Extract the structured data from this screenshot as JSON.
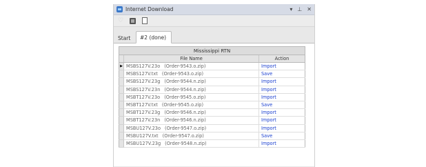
{
  "window": {
    "title": "Internet Download",
    "icon": "globe-download-icon",
    "buttons": [
      "▾",
      "⊥",
      "✕"
    ]
  },
  "toolbar": {
    "icons": [
      "heart-icon",
      "film-icon",
      "document-icon"
    ]
  },
  "tabs": [
    {
      "label": "Start",
      "active": false
    },
    {
      "label": "#2 (done)",
      "active": true
    }
  ],
  "table": {
    "caption": "Mississippi RTN",
    "columns": [
      "File Name",
      "Action"
    ],
    "rows": [
      {
        "file": "MSBS127V.23o",
        "order": "(Order-9543.o.zip)",
        "action": "Import",
        "current": true
      },
      {
        "file": "MSBS127V.txt",
        "order": "(Order-9543.o.zip)",
        "action": "Save"
      },
      {
        "file": "MSBS127V.23g",
        "order": "(Order-9544.n.zip)",
        "action": "Import"
      },
      {
        "file": "MSBS127V.23n",
        "order": "(Order-9544.n.zip)",
        "action": "Import"
      },
      {
        "file": "MSBT127V.23o",
        "order": "(Order-9545.o.zip)",
        "action": "Import"
      },
      {
        "file": "MSBT127V.txt",
        "order": "(Order-9545.o.zip)",
        "action": "Save"
      },
      {
        "file": "MSBT127V.23g",
        "order": "(Order-9546.n.zip)",
        "action": "Import"
      },
      {
        "file": "MSBT127V.23n",
        "order": "(Order-9546.n.zip)",
        "action": "Import"
      },
      {
        "file": "MSBU127V.23o",
        "order": "(Order-9547.o.zip)",
        "action": "Import"
      },
      {
        "file": "MSBU127V.txt",
        "order": "(Order-9547.o.zip)",
        "action": "Save"
      },
      {
        "file": "MSBU127V.23g",
        "order": "(Order-9548.n.zip)",
        "action": "Import"
      }
    ]
  },
  "colors": {
    "link": "#1a3fcf",
    "titlebar": "#d6dbe6",
    "file_text": "#666666"
  }
}
